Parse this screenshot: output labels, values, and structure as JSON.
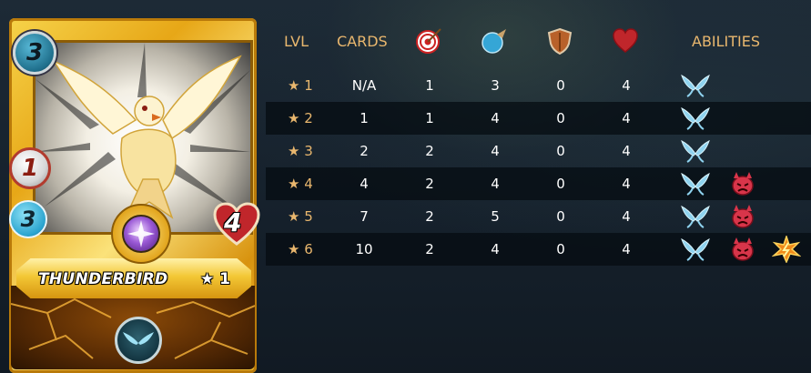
{
  "card": {
    "name": "THUNDERBIRD",
    "level_label": "★ 1",
    "mana": "3",
    "attack": "1",
    "speed": "3",
    "health": "4",
    "rarity_frame": "gold",
    "element_icon": "purple-star-gem",
    "ability_icon": "flying-icon"
  },
  "table": {
    "headers": {
      "lvl": "LVL",
      "cards": "CARDS",
      "ranged_icon": "target-icon",
      "speed_icon": "speed-icon",
      "armor_icon": "shield-icon",
      "health_icon": "heart-icon",
      "abilities": "ABILITIES"
    },
    "rows": [
      {
        "lvl": "★ 1",
        "cards": "N/A",
        "ranged": "1",
        "speed": "3",
        "armor": "0",
        "health": "4",
        "abilities": [
          "flying-icon"
        ]
      },
      {
        "lvl": "★ 2",
        "cards": "1",
        "ranged": "1",
        "speed": "4",
        "armor": "0",
        "health": "4",
        "abilities": [
          "flying-icon"
        ]
      },
      {
        "lvl": "★ 3",
        "cards": "2",
        "ranged": "2",
        "speed": "4",
        "armor": "0",
        "health": "4",
        "abilities": [
          "flying-icon"
        ]
      },
      {
        "lvl": "★ 4",
        "cards": "4",
        "ranged": "2",
        "speed": "4",
        "armor": "0",
        "health": "4",
        "abilities": [
          "flying-icon",
          "demoralize-icon"
        ]
      },
      {
        "lvl": "★ 5",
        "cards": "7",
        "ranged": "2",
        "speed": "5",
        "armor": "0",
        "health": "4",
        "abilities": [
          "flying-icon",
          "demoralize-icon"
        ]
      },
      {
        "lvl": "★ 6",
        "cards": "10",
        "ranged": "2",
        "speed": "4",
        "armor": "0",
        "health": "4",
        "abilities": [
          "flying-icon",
          "demoralize-icon",
          "stun-icon"
        ]
      }
    ]
  },
  "colors": {
    "header_text": "#e9b76e",
    "cell_text": "#ffffff",
    "row_dark": "#050c12"
  }
}
